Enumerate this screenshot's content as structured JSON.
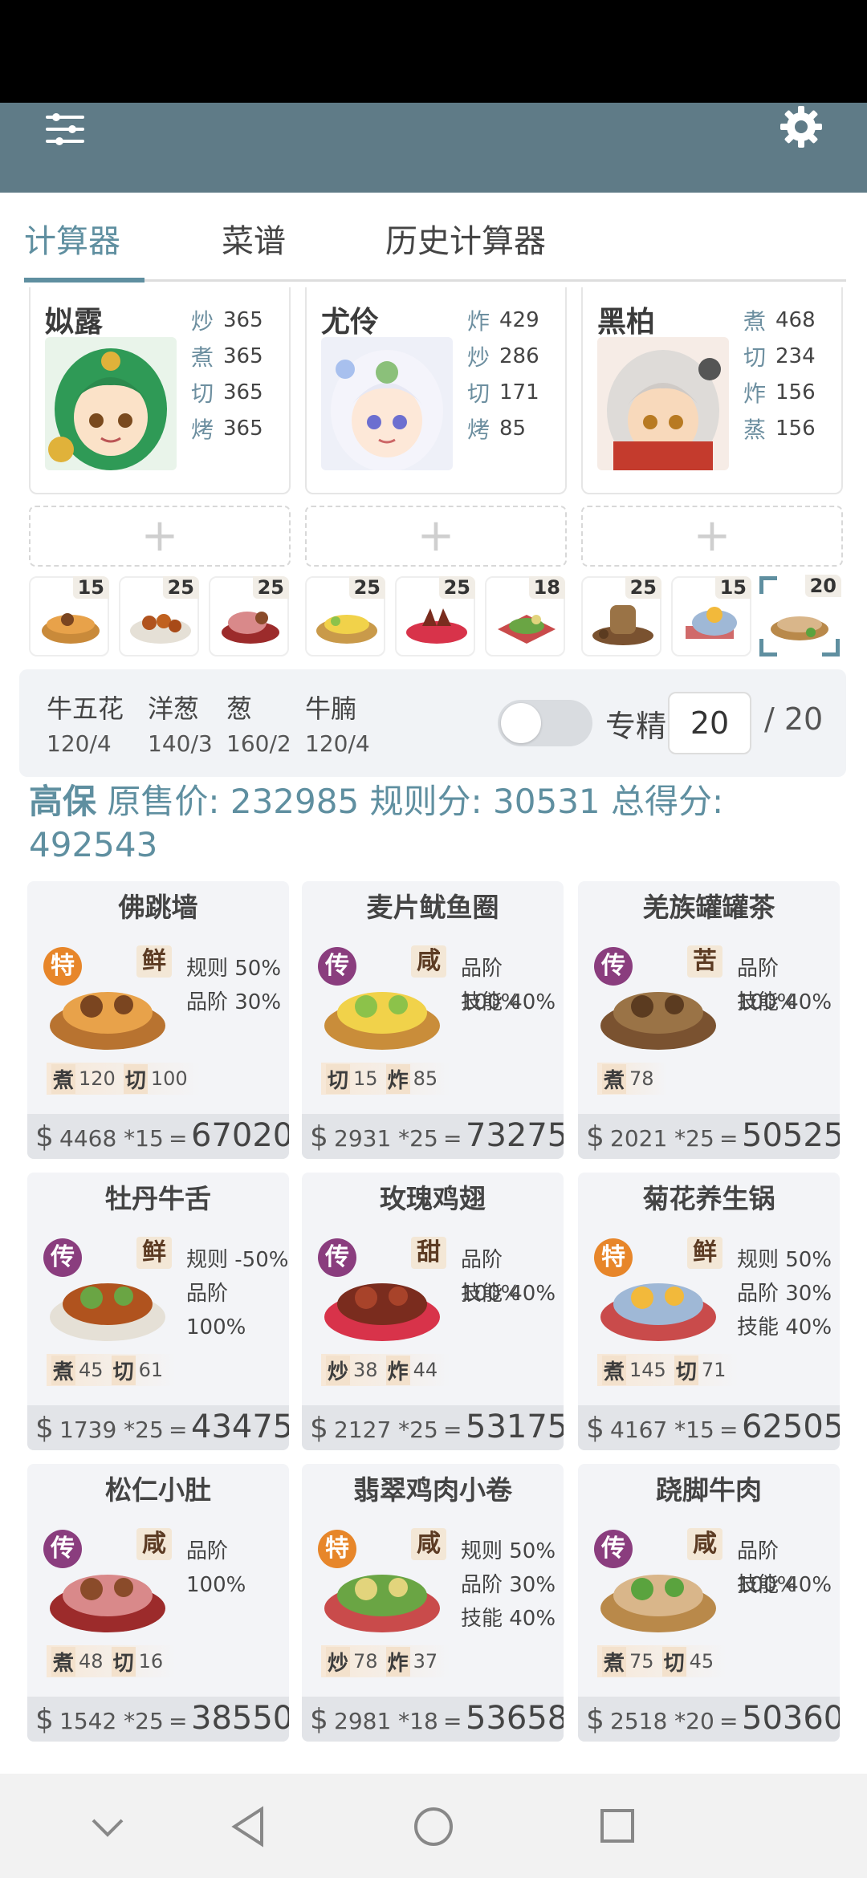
{
  "colors": {
    "appbar": "#5f7b87",
    "accent": "#5f8fa0",
    "chuan_badge": "#8a3d7e",
    "te_badge": "#e7862a"
  },
  "appbar": {
    "menu_icon": "sliders-icon",
    "settings_icon": "gear-icon"
  },
  "tabs": [
    {
      "label": "计算器",
      "active": true
    },
    {
      "label": "菜谱",
      "active": false
    },
    {
      "label": "历史计算器",
      "active": false
    }
  ],
  "chefs": [
    {
      "name": "姒露",
      "skills": [
        {
          "k": "炒",
          "v": "365"
        },
        {
          "k": "煮",
          "v": "365"
        },
        {
          "k": "切",
          "v": "365"
        },
        {
          "k": "烤",
          "v": "365"
        }
      ]
    },
    {
      "name": "尤伶",
      "skills": [
        {
          "k": "炸",
          "v": "429"
        },
        {
          "k": "炒",
          "v": "286"
        },
        {
          "k": "切",
          "v": "171"
        },
        {
          "k": "烤",
          "v": "85"
        }
      ]
    },
    {
      "name": "黑柏",
      "skills": [
        {
          "k": "煮",
          "v": "468"
        },
        {
          "k": "切",
          "v": "234"
        },
        {
          "k": "炸",
          "v": "156"
        },
        {
          "k": "蒸",
          "v": "156"
        }
      ]
    }
  ],
  "add_label": "+",
  "dish_slots": [
    "15",
    "25",
    "25",
    "25",
    "25",
    "18",
    "25",
    "15",
    "20"
  ],
  "ingredients": [
    {
      "name": "牛五花",
      "amount": "120/4"
    },
    {
      "name": "洋葱",
      "amount": "140/3"
    },
    {
      "name": "葱",
      "amount": "160/2"
    },
    {
      "name": "牛腩",
      "amount": "120/4"
    }
  ],
  "specialize": {
    "label": "专精",
    "value": "20",
    "max": "/ 20",
    "on": false
  },
  "summary": {
    "lead": "高保",
    "text": " 原售价: 232985 规则分: 30531 总得分: 492543"
  },
  "cards": [
    {
      "title": "佛跳墙",
      "badge": "特",
      "flavor": "鲜",
      "rules": [
        "规则 50%",
        "品阶 30%"
      ],
      "skills": [
        {
          "k": "煮",
          "v": "120"
        },
        {
          "k": "切",
          "v": "100"
        }
      ],
      "price": "4468 *15",
      "total": "67020"
    },
    {
      "title": "麦片鱿鱼圈",
      "badge": "传",
      "flavor": "咸",
      "rules": [
        "品阶 100%",
        "技能 40%"
      ],
      "skills": [
        {
          "k": "切",
          "v": "15"
        },
        {
          "k": "炸",
          "v": "85"
        }
      ],
      "price": "2931 *25",
      "total": "73275"
    },
    {
      "title": "羌族罐罐茶",
      "badge": "传",
      "flavor": "苦",
      "rules": [
        "品阶 100%",
        "技能 40%"
      ],
      "skills": [
        {
          "k": "煮",
          "v": "78"
        }
      ],
      "price": "2021 *25",
      "total": "50525"
    },
    {
      "title": "牡丹牛舌",
      "badge": "传",
      "flavor": "鲜",
      "rules": [
        "规则 -50%",
        "品阶 100%"
      ],
      "skills": [
        {
          "k": "煮",
          "v": "45"
        },
        {
          "k": "切",
          "v": "61"
        }
      ],
      "price": "1739 *25",
      "total": "43475"
    },
    {
      "title": "玫瑰鸡翅",
      "badge": "传",
      "flavor": "甜",
      "rules": [
        "品阶 100%",
        "技能 40%"
      ],
      "skills": [
        {
          "k": "炒",
          "v": "38"
        },
        {
          "k": "炸",
          "v": "44"
        }
      ],
      "price": "2127 *25",
      "total": "53175"
    },
    {
      "title": "菊花养生锅",
      "badge": "特",
      "flavor": "鲜",
      "rules": [
        "规则 50%",
        "品阶 30%",
        "技能 40%"
      ],
      "skills": [
        {
          "k": "煮",
          "v": "145"
        },
        {
          "k": "切",
          "v": "71"
        }
      ],
      "price": "4167 *15",
      "total": "62505"
    },
    {
      "title": "松仁小肚",
      "badge": "传",
      "flavor": "咸",
      "rules": [
        "品阶 100%"
      ],
      "skills": [
        {
          "k": "煮",
          "v": "48"
        },
        {
          "k": "切",
          "v": "16"
        }
      ],
      "price": "1542 *25",
      "total": "38550"
    },
    {
      "title": "翡翠鸡肉小卷",
      "badge": "特",
      "flavor": "咸",
      "rules": [
        "规则 50%",
        "品阶 30%",
        "技能 40%"
      ],
      "skills": [
        {
          "k": "炒",
          "v": "78"
        },
        {
          "k": "炸",
          "v": "37"
        }
      ],
      "price": "2981 *18",
      "total": "53658"
    },
    {
      "title": "跷脚牛肉",
      "badge": "传",
      "flavor": "咸",
      "rules": [
        "品阶 100%",
        "技能 40%"
      ],
      "skills": [
        {
          "k": "煮",
          "v": "75"
        },
        {
          "k": "切",
          "v": "45"
        }
      ],
      "price": "2518 *20",
      "total": "50360"
    }
  ],
  "currency": "$",
  "equals": "=",
  "navbar": {
    "icons": [
      "chevron-down-icon",
      "back-icon",
      "home-icon",
      "recents-icon"
    ]
  }
}
